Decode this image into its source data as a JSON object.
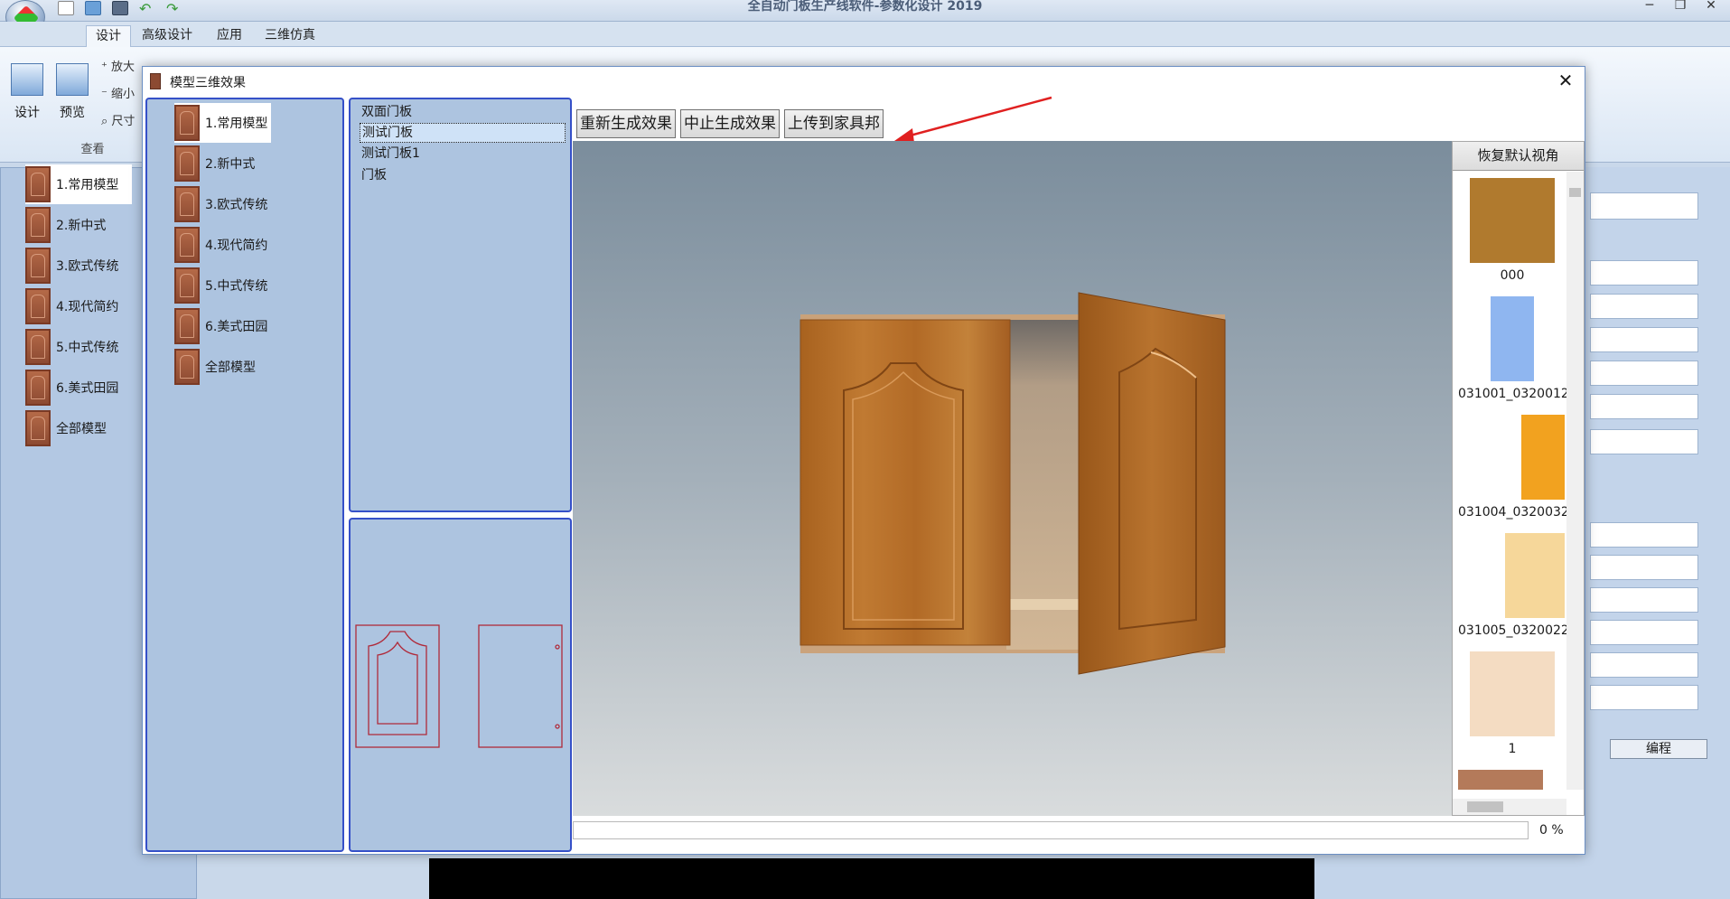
{
  "app": {
    "title": "全自动门板生产线软件-参数化设计 2019",
    "minimize": "─",
    "restore": "❐",
    "close": "✕"
  },
  "ribbon": {
    "tabs": [
      "设计",
      "高级设计",
      "应用",
      "三维仿真"
    ],
    "design_label": "设计",
    "preview_label": "预览",
    "zoom_in": "放大",
    "zoom_out": "缩小",
    "dimension": "尺寸",
    "group_view": "查看"
  },
  "tree": {
    "items": [
      "1.常用模型",
      "2.新中式",
      "3.欧式传统",
      "4.现代简约",
      "5.中式传统",
      "6.美式田园",
      "全部模型"
    ]
  },
  "right_app": {
    "edit_button": "编程"
  },
  "dialog": {
    "title": "模型三维效果",
    "close": "✕",
    "categories": [
      "1.常用模型",
      "2.新中式",
      "3.欧式传统",
      "4.现代简约",
      "5.中式传统",
      "6.美式田园",
      "全部模型"
    ],
    "door_list": [
      "双面门板",
      "测试门板",
      "测试门板1",
      "门板"
    ],
    "buttons": {
      "regenerate": "重新生成效果",
      "stop": "中止生成效果",
      "upload": "上传到家具邦"
    },
    "progress": {
      "value": 0,
      "label": "0 %"
    },
    "materials": {
      "restore_view": "恢复默认视角",
      "items": [
        {
          "name": "000",
          "color": "#b07a2e"
        },
        {
          "name": "031001_0320012",
          "color": "#8fb6f0"
        },
        {
          "name": "031004_0320032",
          "color": "#f2a21f"
        },
        {
          "name": "031005_0320022",
          "color": "#f6d79a"
        },
        {
          "name": "1",
          "color": "#f4dcc2"
        }
      ]
    }
  },
  "colors": {
    "accent": "#3550c8",
    "panel": "#adc4e0",
    "annotation_arrow": "#e02020",
    "wood": "#b06a2a"
  }
}
